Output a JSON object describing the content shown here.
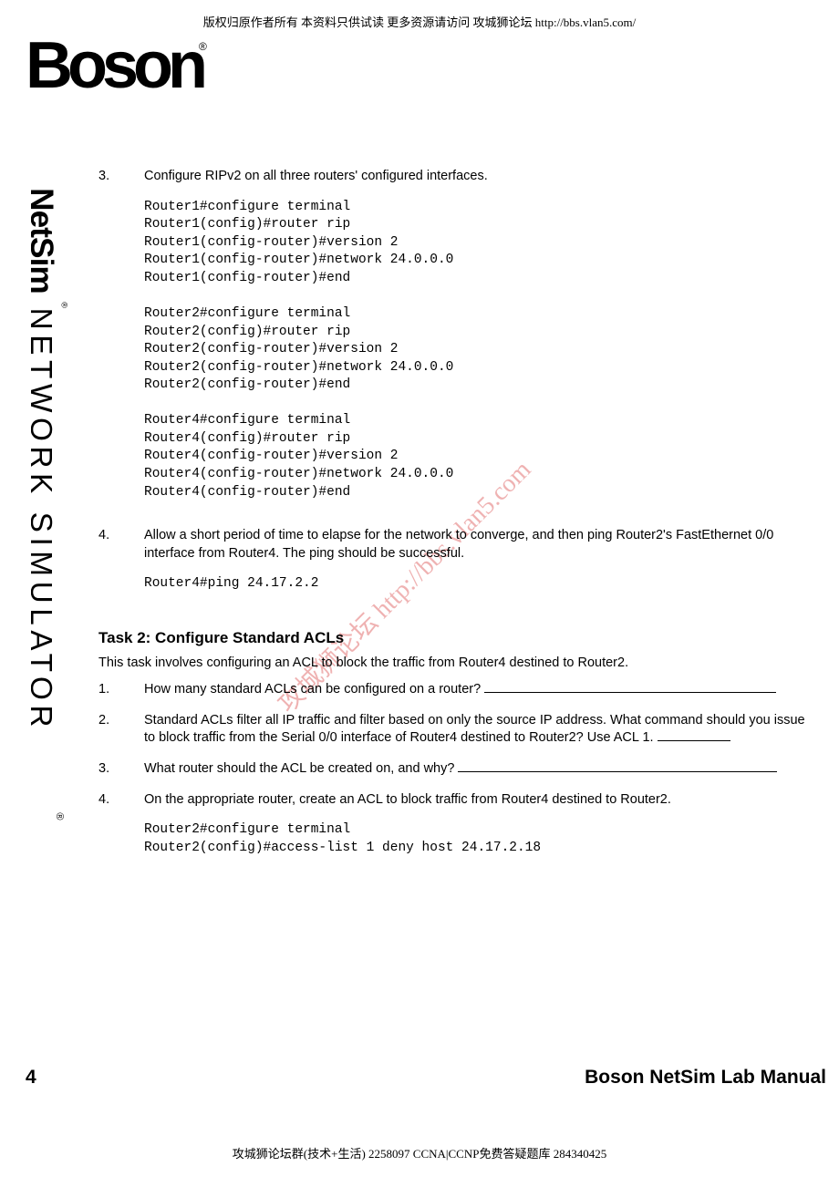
{
  "header": "版权归原作者所有 本资料只供试读 更多资源请访问 攻城狮论坛 http://bbs.vlan5.com/",
  "logo": {
    "text": "Boson",
    "reg": "®"
  },
  "sidebar": {
    "brand": "NetSim",
    "reg": "®",
    "product": " NETWORK SIMULATOR",
    "reg2": "®"
  },
  "steps": {
    "s3": {
      "num": "3.",
      "text": "Configure RIPv2 on all three routers' configured interfaces.",
      "code": "Router1#configure terminal\nRouter1(config)#router rip\nRouter1(config-router)#version 2\nRouter1(config-router)#network 24.0.0.0\nRouter1(config-router)#end\n\nRouter2#configure terminal\nRouter2(config)#router rip\nRouter2(config-router)#version 2\nRouter2(config-router)#network 24.0.0.0\nRouter2(config-router)#end\n\nRouter4#configure terminal\nRouter4(config)#router rip\nRouter4(config-router)#version 2\nRouter4(config-router)#network 24.0.0.0\nRouter4(config-router)#end"
    },
    "s4": {
      "num": "4.",
      "text": "Allow a short period of time to elapse for the network to converge, and then ping Router2's FastEthernet 0/0 interface from Router4. The ping should be successful.",
      "code": "Router4#ping 24.17.2.2"
    }
  },
  "task2": {
    "heading": "Task 2: Configure Standard ACLs",
    "intro": "This task involves configuring an ACL to block the traffic from Router4 destined to Router2.",
    "q1": {
      "num": "1.",
      "text": "How many standard ACLs can be configured on a router?  "
    },
    "q2": {
      "num": "2.",
      "text": "Standard ACLs filter all IP traffic and filter based on only the source IP address. What command should you issue to block traffic from the Serial 0/0 interface of Router4 destined to Router2? Use ACL 1.  "
    },
    "q3": {
      "num": "3.",
      "text": "What router should the ACL be created on, and why?  "
    },
    "q4": {
      "num": "4.",
      "text": "On the appropriate router, create an ACL to block traffic from Router4 destined to Router2.",
      "code": "Router2#configure terminal\nRouter2(config)#access-list 1 deny host 24.17.2.18"
    }
  },
  "watermark": "攻城狮论坛 http://bbs.vlan5.com",
  "page_num": "4",
  "manual_title": "Boson NetSim Lab Manual",
  "footer": "攻城狮论坛群(技术+生活) 2258097 CCNA|CCNP免费答疑题库 284340425"
}
